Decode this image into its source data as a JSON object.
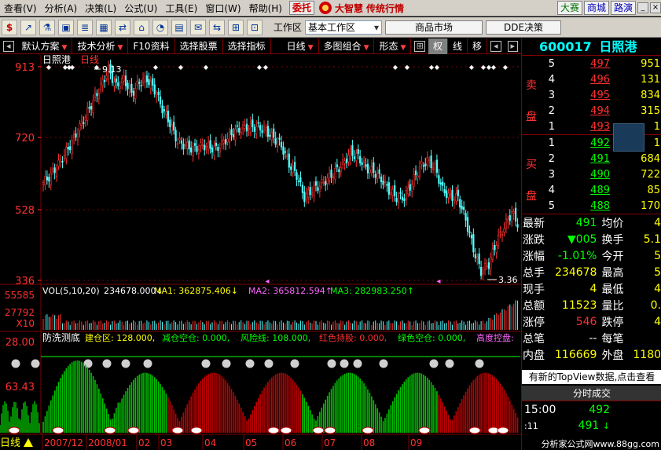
{
  "menu": {
    "items": [
      "查看(V)",
      "分析(A)",
      "决策(L)",
      "公式(U)",
      "工具(E)",
      "窗口(W)",
      "帮助(H)"
    ],
    "trust_button": "委托",
    "brand": "大智慧",
    "brand_sub": "传统行情",
    "right_buttons": [
      "大赛",
      "商城",
      "路演"
    ]
  },
  "toolbar": {
    "icons": [
      "$",
      "↗",
      "⚗",
      "▣",
      "≣",
      "▦",
      "⇄",
      "⌂",
      "◔",
      "▤",
      "✉",
      "⇆",
      "⊞",
      "⊡"
    ],
    "workspace_label": "工作区",
    "workspace_value": "基本工作区",
    "tabs": [
      "商品市场",
      "DDE决策"
    ]
  },
  "tabbar": {
    "items": [
      "默认方案",
      "技术分析",
      "F10资料",
      "选择股票",
      "选择指标",
      "日线",
      "多图组合",
      "形态"
    ],
    "right": [
      "权",
      "线",
      "移"
    ]
  },
  "chart": {
    "title_name": "日照港",
    "title_period": "日线",
    "y_labels": [
      "913",
      "720",
      "528",
      "336"
    ],
    "high_label": "9.13",
    "low_label": "3.36",
    "vol_label": "VOL(5,10,20)",
    "vol_value": "234678.000↓",
    "ma1": "MA1: 362875.406↓",
    "ma2": "MA2: 365812.594↑",
    "ma3": "MA3: 282983.250↑",
    "vol_y": [
      "55585",
      "27792",
      "X10"
    ],
    "ind_name": "防洗测底",
    "ind_items": [
      {
        "text": "建仓区: 128.000,",
        "color": "#ffff00"
      },
      {
        "text": "减仓空仓: 0.000,",
        "color": "#00ff00"
      },
      {
        "text": "风险线: 108.000,",
        "color": "#00ff00"
      },
      {
        "text": "红色持股: 0.000,",
        "color": "#ff3030"
      },
      {
        "text": "绿色空仓: 0.000,",
        "color": "#00ff00"
      },
      {
        "text": "高度控盘:",
        "color": "#ff66ff"
      }
    ],
    "ind_y": [
      "28.00",
      "63.43"
    ],
    "x_labels": [
      "2007/12",
      "2008/01",
      "02",
      "03",
      "04",
      "05",
      "06",
      "07",
      "08",
      "09"
    ],
    "bottom_tab": "日线"
  },
  "stock": {
    "code": "600017",
    "name": "日照港"
  },
  "sell_side_label": "卖盘",
  "buy_side_label": "买盘",
  "sell": [
    {
      "level": "5",
      "price": "497",
      "vol": "951"
    },
    {
      "level": "4",
      "price": "496",
      "vol": "131"
    },
    {
      "level": "3",
      "price": "495",
      "vol": "834"
    },
    {
      "level": "2",
      "price": "494",
      "vol": "315"
    },
    {
      "level": "1",
      "price": "493",
      "vol": "1"
    }
  ],
  "buy": [
    {
      "level": "1",
      "price": "492",
      "vol": "1"
    },
    {
      "level": "2",
      "price": "491",
      "vol": "684"
    },
    {
      "level": "3",
      "price": "490",
      "vol": "722"
    },
    {
      "level": "4",
      "price": "489",
      "vol": "85"
    },
    {
      "level": "5",
      "price": "488",
      "vol": "170"
    }
  ],
  "stats": [
    {
      "k1": "最新",
      "v1": "491",
      "c1": "c-g",
      "k2": "均价",
      "v2": "4"
    },
    {
      "k1": "涨跌",
      "v1": "▼005",
      "c1": "c-g",
      "k2": "换手",
      "v2": "5.1"
    },
    {
      "k1": "涨幅",
      "v1": "-1.01%",
      "c1": "c-g",
      "k2": "今开",
      "v2": "5"
    },
    {
      "k1": "总手",
      "v1": "234678",
      "c1": "c-y",
      "k2": "最高",
      "v2": "5"
    },
    {
      "k1": "现手",
      "v1": "4",
      "c1": "c-y",
      "k2": "最低",
      "v2": "4"
    },
    {
      "k1": "总额",
      "v1": "11523",
      "c1": "c-y",
      "k2": "量比",
      "v2": "0."
    },
    {
      "k1": "涨停",
      "v1": "546",
      "c1": "c-r",
      "k2": "跌停",
      "v2": "4"
    },
    {
      "k1": "总笔",
      "v1": "--",
      "c1": "c-w",
      "k2": "每笔",
      "v2": ""
    },
    {
      "k1": "内盘",
      "v1": "116669",
      "c1": "c-y",
      "k2": "外盘",
      "v2": "1180"
    }
  ],
  "notice": "有新的TopView数据,点击查看",
  "tick_title": "分时成交",
  "ticks": [
    {
      "time": "15:00",
      "price": "492",
      "vol": ""
    },
    {
      "time": ":11",
      "price": "491",
      "vol": ""
    }
  ],
  "footer_ad": "分析家公式网www.88gg.com"
}
